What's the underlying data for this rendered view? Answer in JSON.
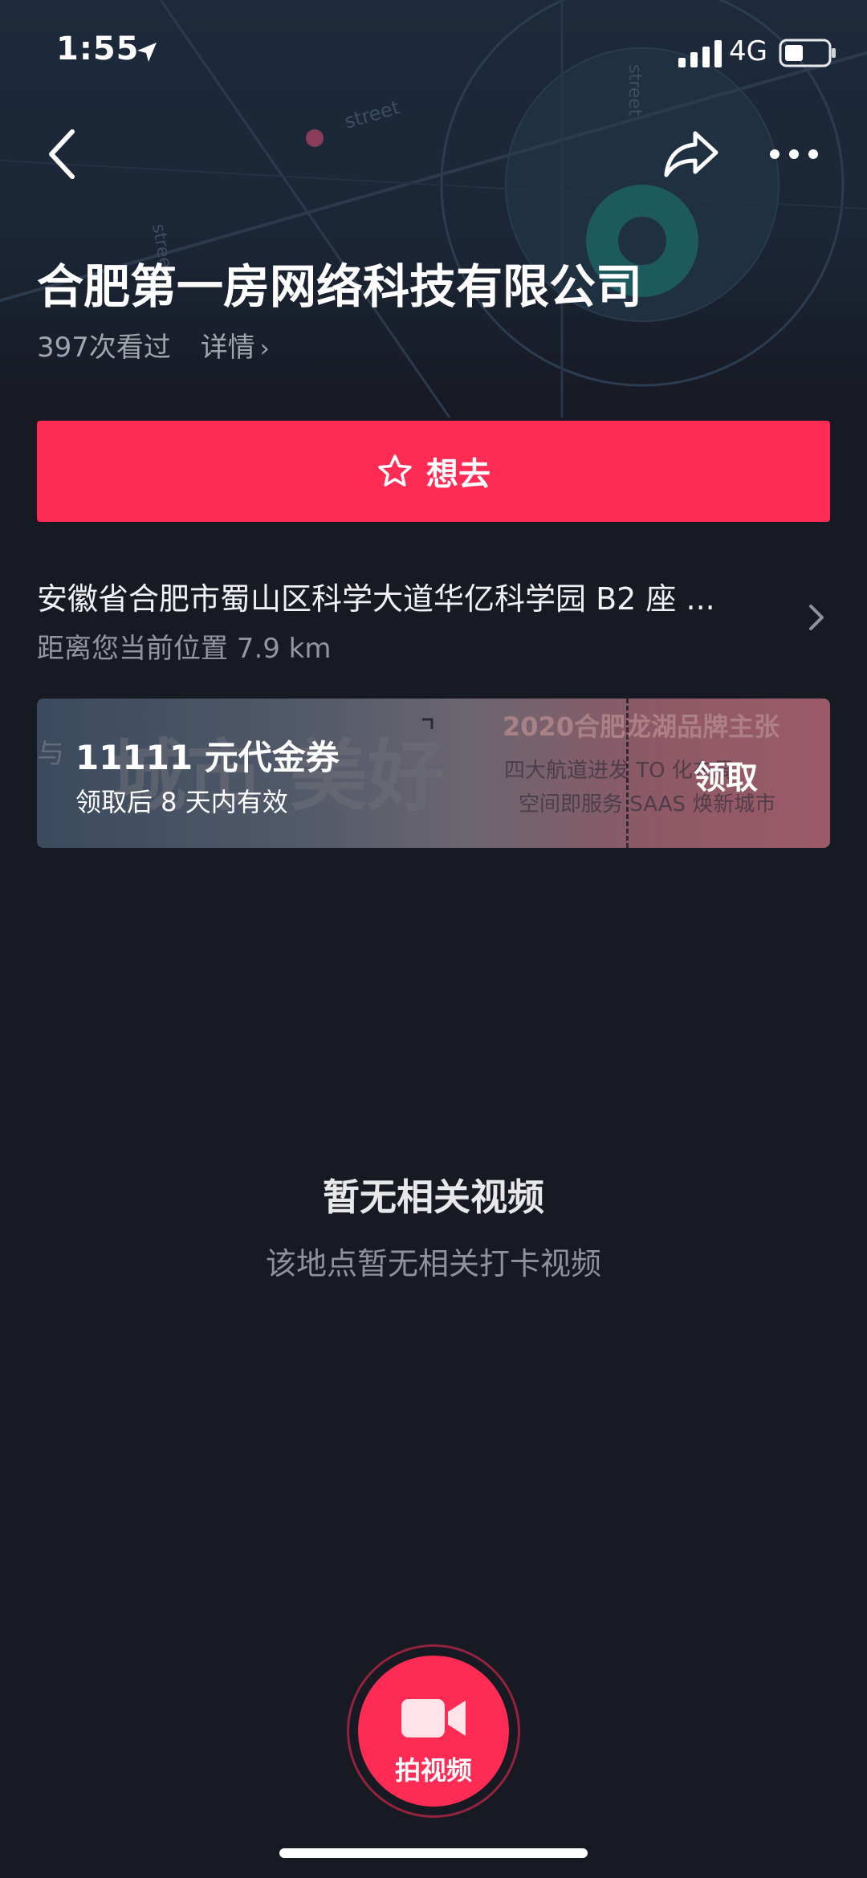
{
  "status_bar": {
    "time": "1:55",
    "network": "4G"
  },
  "map_labels": {
    "street_1": "street",
    "street_2": "street",
    "street_3": "street"
  },
  "header": {
    "title": "合肥第一房网络科技有限公司",
    "views": "397次看过",
    "details_label": "详情"
  },
  "want_button": {
    "label": "想去"
  },
  "address": {
    "text": "安徽省合肥市蜀山区科学大道华亿科学园 B2 座 ...",
    "distance": "距离您当前位置 7.9 km"
  },
  "coupon": {
    "amount": "11111 元代金券",
    "validity": "领取后 8 天内有效",
    "claim_label": "领取",
    "banner_headline": "2020合肥龙湖品牌主张",
    "banner_line_1": "四大航道进发   TO      化布局",
    "banner_line_2": "空间即服务   SAAS   焕新城市",
    "banner_calligraphy": "城市   美好",
    "banner_small": "与"
  },
  "empty_state": {
    "title": "暂无相关视频",
    "subtitle": "该地点暂无相关打卡视频"
  },
  "record_button": {
    "label": "拍视频"
  },
  "colors": {
    "accent": "#fe2c55",
    "background": "#171923",
    "secondary_text": "#93969e"
  }
}
